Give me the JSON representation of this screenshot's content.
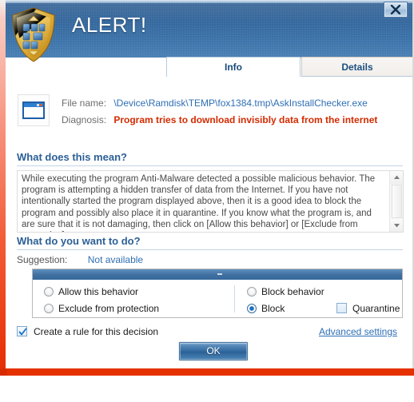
{
  "window": {
    "title": "ALERT!",
    "close_label": "×",
    "logo_name": "emsisoft-shield-logo"
  },
  "tabs": [
    {
      "id": "info",
      "label": "Info",
      "active": true
    },
    {
      "id": "details",
      "label": "Details",
      "active": false
    }
  ],
  "file_info": {
    "file_name_label": "File name:",
    "file_name_value": "\\Device\\Ramdisk\\TEMP\\fox1384.tmp\\AskInstallChecker.exe",
    "diagnosis_label": "Diagnosis:",
    "diagnosis_value": "Program tries to download invisibly data from the internet",
    "icon_name": "application-window-icon"
  },
  "explanation": {
    "heading": "What does this mean?",
    "body": "While executing the program Anti-Malware detected a possible malicious behavior. The program is attempting a hidden transfer of data from the Internet. If you have not intentionally started the program displayed above, then it is a good idea to block the program and possibly also place it in quarantine. If you know what the program is, and are sure that it is not damaging, then click on [Allow this behavior] or [Exclude from protection]."
  },
  "actions": {
    "heading": "What do you want to do?",
    "suggestion_label": "Suggestion:",
    "suggestion_value": "Not available",
    "options": [
      {
        "id": "allow",
        "label": "Allow this behavior",
        "type": "radio",
        "checked": false
      },
      {
        "id": "exclude",
        "label": "Exclude from protection",
        "type": "radio",
        "checked": false
      },
      {
        "id": "block-behavior",
        "label": "Block behavior",
        "type": "radio",
        "checked": false
      },
      {
        "id": "block",
        "label": "Block",
        "type": "radio",
        "checked": true
      },
      {
        "id": "quarantine",
        "label": "Quarantine",
        "type": "checkbox",
        "checked": false
      }
    ]
  },
  "footer": {
    "create_rule_label": "Create a rule for this decision",
    "create_rule_checked": true,
    "advanced_settings_label": "Advanced settings",
    "ok_label": "OK"
  },
  "colors": {
    "titlebar_blue": "#36699e",
    "accent_red": "#e53100",
    "diagnosis_red": "#d32b00",
    "link_blue": "#2f6fb5",
    "heading_blue": "#2b5f96",
    "radio_selected_blue": "#1f6fc4"
  }
}
